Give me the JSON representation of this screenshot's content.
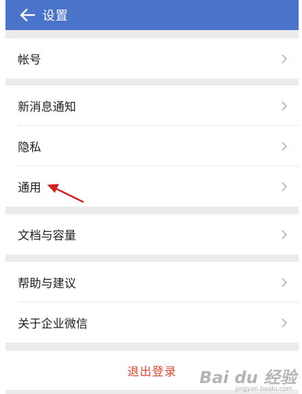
{
  "header": {
    "title": "设置",
    "back_icon": "arrow-left-icon"
  },
  "colors": {
    "header_bg": "#4a74c9",
    "logout_text": "#e0472f",
    "annotation_arrow": "#d42020"
  },
  "groups": [
    {
      "items": [
        {
          "label": "帐号"
        }
      ]
    },
    {
      "items": [
        {
          "label": "新消息通知"
        },
        {
          "label": "隐私"
        },
        {
          "label": "通用"
        }
      ]
    },
    {
      "items": [
        {
          "label": "文档与容量"
        }
      ]
    },
    {
      "items": [
        {
          "label": "帮助与建议"
        },
        {
          "label": "关于企业微信"
        }
      ]
    }
  ],
  "logout": {
    "label": "退出登录"
  },
  "watermark": {
    "logo": "Bai du 经验",
    "url": "jingyan.baidu.com"
  }
}
